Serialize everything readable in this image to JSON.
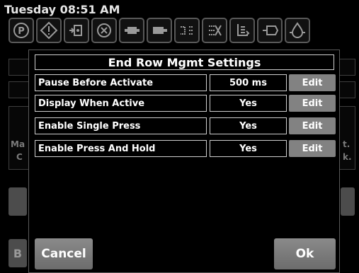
{
  "status_bar": {
    "datetime": "Tuesday 08:51 AM"
  },
  "toolbar": {
    "icons": [
      "parking-icon",
      "warning-icon",
      "hydraulic-valve-icon",
      "pressure-gauge-icon",
      "pump-icon",
      "motor-icon",
      "flow-icon",
      "disabled-flow-icon",
      "lift-icon",
      "tank-valve-icon",
      "oil-drop-icon"
    ]
  },
  "background": {
    "left_partial_text_1": "Ma",
    "left_partial_text_2": "C",
    "right_partial_text_1": "t.",
    "right_partial_text_2": "k.",
    "bottom_left_partial": "B"
  },
  "dialog": {
    "title": "End Row Mgmt Settings",
    "rows": [
      {
        "label": "Pause Before Activate",
        "value": "500 ms",
        "action": "Edit"
      },
      {
        "label": "Display When Active",
        "value": "Yes",
        "action": "Edit"
      },
      {
        "label": "Enable Single Press",
        "value": "Yes",
        "action": "Edit"
      },
      {
        "label": "Enable Press And Hold",
        "value": "Yes",
        "action": "Edit"
      }
    ],
    "cancel_label": "Cancel",
    "ok_label": "Ok"
  }
}
